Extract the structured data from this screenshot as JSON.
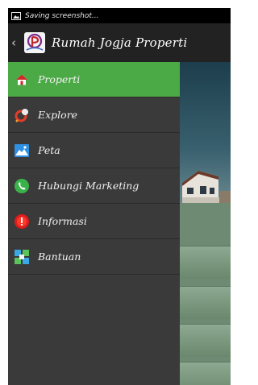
{
  "status_bar": {
    "text": "Saving screenshot...",
    "icon": "image-icon"
  },
  "app_bar": {
    "back_glyph": "‹",
    "title": "Rumah Jogja Properti",
    "logo": "app-logo"
  },
  "drawer": {
    "items": [
      {
        "label": "Properti",
        "icon": "home-icon",
        "active": true
      },
      {
        "label": "Explore",
        "icon": "explore-icon"
      },
      {
        "label": "Peta",
        "icon": "map-image-icon"
      },
      {
        "label": "Hubungi Marketing",
        "icon": "phone-icon"
      },
      {
        "label": "Informasi",
        "icon": "info-icon"
      },
      {
        "label": "Bantuan",
        "icon": "help-grid-icon"
      }
    ]
  },
  "colors": {
    "active": "#4caa46",
    "drawer_bg": "#3a3a3a",
    "appbar_bg": "#222222"
  }
}
